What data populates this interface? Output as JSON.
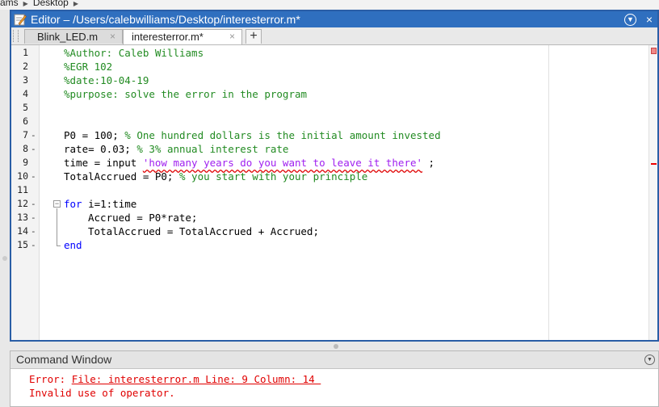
{
  "breadcrumb": {
    "items": [
      "ams",
      "Desktop"
    ]
  },
  "window": {
    "title": "Editor – /Users/calebwilliams/Desktop/interesterror.m*",
    "menu_icon": "chevron-down-icon",
    "close_label": "×"
  },
  "tabs": [
    {
      "label": "Blink_LED.m",
      "close": "×"
    },
    {
      "label": "interesterror.m*",
      "close": "×"
    }
  ],
  "add_tab_label": "+",
  "editor": {
    "lines": [
      {
        "num": "1",
        "dash": "",
        "text": "%Author: Caleb Williams"
      },
      {
        "num": "2",
        "dash": "",
        "text": "%EGR 102"
      },
      {
        "num": "3",
        "dash": "",
        "text": "%date:10-04-19"
      },
      {
        "num": "4",
        "dash": "",
        "text": "%purpose: solve the error in the program"
      },
      {
        "num": "5",
        "dash": "",
        "text": ""
      },
      {
        "num": "6",
        "dash": "",
        "text": ""
      },
      {
        "num": "7",
        "dash": "-",
        "code": "P0 = 100; ",
        "comment": "% One hundred dollars is the initial amount invested"
      },
      {
        "num": "8",
        "dash": "-",
        "code": "rate= 0.03; ",
        "comment": "% 3% annual interest rate"
      },
      {
        "num": "9",
        "dash": "",
        "code": "time = input ",
        "string": "'how many years do you want to leave it there'",
        "tail": " ;"
      },
      {
        "num": "10",
        "dash": "-",
        "code": "TotalAccrued = P0; ",
        "comment": "% you start with your principle"
      },
      {
        "num": "11",
        "dash": "",
        "text": ""
      },
      {
        "num": "12",
        "dash": "-",
        "keyword": "for",
        "code": " i=1:time"
      },
      {
        "num": "13",
        "dash": "-",
        "code": "Accrued = P0*rate;"
      },
      {
        "num": "14",
        "dash": "-",
        "code": "TotalAccrued = TotalAccrued + Accrued;"
      },
      {
        "num": "15",
        "dash": "-",
        "keyword": "end"
      }
    ]
  },
  "command_window": {
    "title": "Command Window",
    "error_prefix": "Error: ",
    "error_link": "File: interesterror.m Line: 9 Column: 14 ",
    "error_message": "Invalid use of operator."
  },
  "colors": {
    "titlebar": "#2f6fbf",
    "comment": "#228b22",
    "keyword": "#0000ff",
    "string": "#a020f0",
    "error": "#e00000"
  }
}
